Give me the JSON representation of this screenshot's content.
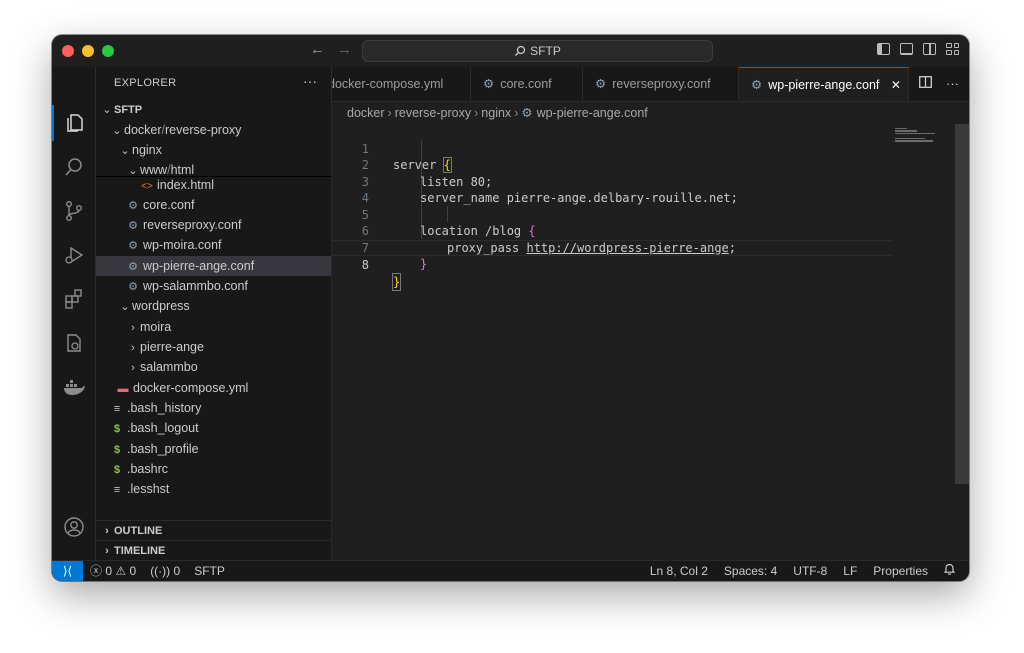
{
  "titlebar": {
    "command_center": "SFTP"
  },
  "colors": {
    "accent": "#0078d4",
    "close": "#ff5f57",
    "minimize": "#febc2e",
    "zoom": "#28c840"
  },
  "sidebar": {
    "header": "EXPLORER",
    "more": "···",
    "root": "SFTP",
    "tree": [
      {
        "label": "docker",
        "sep": "/",
        "label2": "reverse-proxy"
      },
      {
        "label": "nginx"
      },
      {
        "label": "www",
        "sep": "/",
        "label2": "html"
      },
      {
        "label": "index.html"
      },
      {
        "label": "core.conf"
      },
      {
        "label": "reverseproxy.conf"
      },
      {
        "label": "wp-moira.conf"
      },
      {
        "label": "wp-pierre-ange.conf"
      },
      {
        "label": "wp-salammbo.conf"
      },
      {
        "label": "wordpress"
      },
      {
        "label": "moira"
      },
      {
        "label": "pierre-ange"
      },
      {
        "label": "salammbo"
      },
      {
        "label": "docker-compose.yml"
      },
      {
        "label": ".bash_history"
      },
      {
        "label": ".bash_logout"
      },
      {
        "label": ".bash_profile"
      },
      {
        "label": ".bashrc"
      },
      {
        "label": ".lesshst"
      }
    ],
    "outline": "OUTLINE",
    "timeline": "TIMELINE"
  },
  "tabs": [
    {
      "label": "docker-compose.yml"
    },
    {
      "label": "core.conf"
    },
    {
      "label": "reverseproxy.conf"
    },
    {
      "label": "wp-pierre-ange.conf"
    }
  ],
  "tab_close": "✕",
  "breadcrumb": [
    "docker",
    "reverse-proxy",
    "nginx",
    "wp-pierre-ange.conf"
  ],
  "editor": {
    "line_numbers": [
      "1",
      "2",
      "3",
      "4",
      "5",
      "6",
      "7",
      "8"
    ],
    "l1": "server ",
    "l1b": "{",
    "l2": "listen 80;",
    "l3": "server_name pierre-ange.delbary-rouille.net;",
    "l5": "location /blog ",
    "l5b": "{",
    "l6a": "proxy_pass ",
    "l6url": "http://wordpress-pierre-ange",
    "l6c": ";",
    "l7": "}",
    "l8": "}"
  },
  "statusbar": {
    "remote_icon": "⟩⟨",
    "errors": "0",
    "warnings": "0",
    "ports": "0",
    "sftp": "SFTP",
    "position": "Ln 8, Col 2",
    "spaces": "Spaces: 4",
    "encoding": "UTF-8",
    "eol": "LF",
    "properties": "Properties"
  }
}
